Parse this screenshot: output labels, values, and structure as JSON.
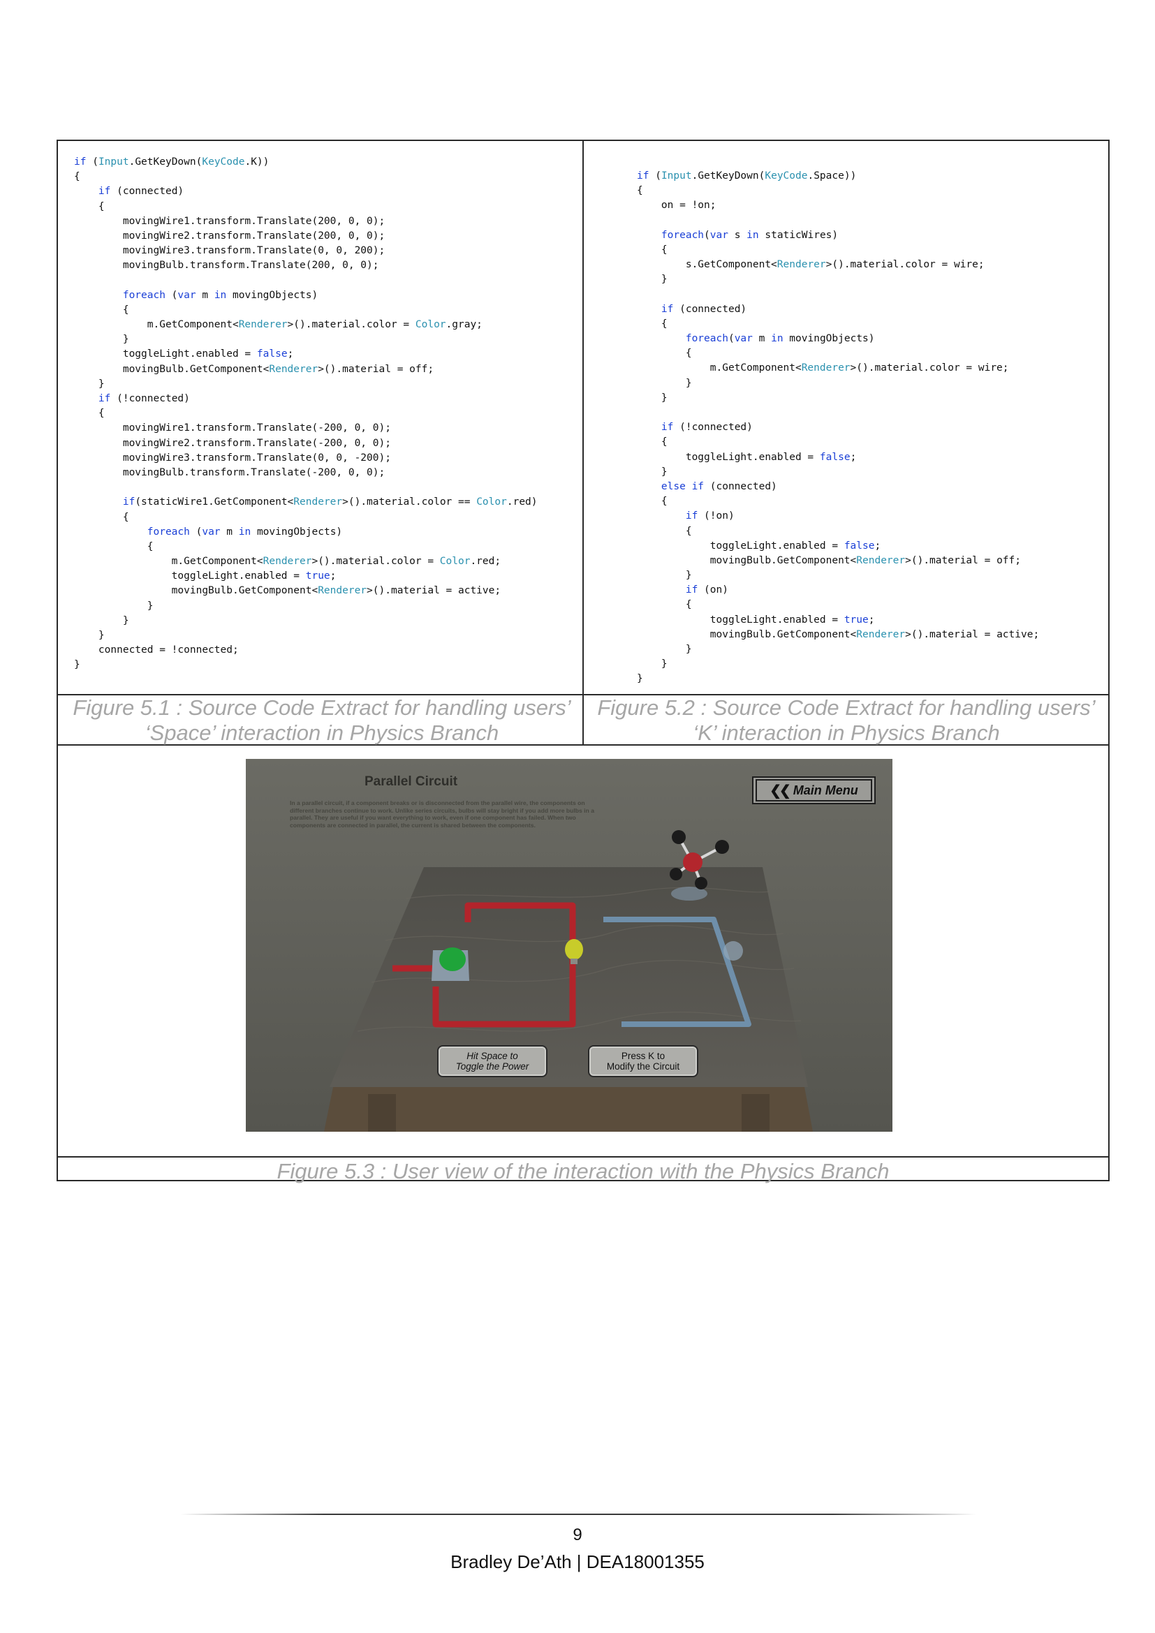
{
  "code_left": [
    [
      {
        "t": "if",
        "c": "kw"
      },
      {
        "t": " ("
      },
      {
        "t": "Input",
        "c": "ty"
      },
      {
        "t": ".GetKeyDown("
      },
      {
        "t": "KeyCode",
        "c": "ty"
      },
      {
        "t": ".K))"
      }
    ],
    [
      {
        "t": "{"
      }
    ],
    [
      {
        "t": "    "
      },
      {
        "t": "if",
        "c": "kw"
      },
      {
        "t": " (connected)"
      }
    ],
    [
      {
        "t": "    {"
      }
    ],
    [
      {
        "t": "        movingWire1.transform.Translate(200, 0, 0);"
      }
    ],
    [
      {
        "t": "        movingWire2.transform.Translate(200, 0, 0);"
      }
    ],
    [
      {
        "t": "        movingWire3.transform.Translate(0, 0, 200);"
      }
    ],
    [
      {
        "t": "        movingBulb.transform.Translate(200, 0, 0);"
      }
    ],
    [
      {
        "t": ""
      }
    ],
    [
      {
        "t": "        "
      },
      {
        "t": "foreach",
        "c": "kw"
      },
      {
        "t": " ("
      },
      {
        "t": "var",
        "c": "kw"
      },
      {
        "t": " m "
      },
      {
        "t": "in",
        "c": "kw"
      },
      {
        "t": " movingObjects)"
      }
    ],
    [
      {
        "t": "        {"
      }
    ],
    [
      {
        "t": "            m.GetComponent<"
      },
      {
        "t": "Renderer",
        "c": "ty"
      },
      {
        "t": ">().material.color = "
      },
      {
        "t": "Color",
        "c": "ty"
      },
      {
        "t": ".gray;"
      }
    ],
    [
      {
        "t": "        }"
      }
    ],
    [
      {
        "t": "        toggleLight.enabled = "
      },
      {
        "t": "false",
        "c": "kw"
      },
      {
        "t": ";"
      }
    ],
    [
      {
        "t": "        movingBulb.GetComponent<"
      },
      {
        "t": "Renderer",
        "c": "ty"
      },
      {
        "t": ">().material = off;"
      }
    ],
    [
      {
        "t": "    }"
      }
    ],
    [
      {
        "t": "    "
      },
      {
        "t": "if",
        "c": "kw"
      },
      {
        "t": " (!connected)"
      }
    ],
    [
      {
        "t": "    {"
      }
    ],
    [
      {
        "t": "        movingWire1.transform.Translate(-200, 0, 0);"
      }
    ],
    [
      {
        "t": "        movingWire2.transform.Translate(-200, 0, 0);"
      }
    ],
    [
      {
        "t": "        movingWire3.transform.Translate(0, 0, -200);"
      }
    ],
    [
      {
        "t": "        movingBulb.transform.Translate(-200, 0, 0);"
      }
    ],
    [
      {
        "t": ""
      }
    ],
    [
      {
        "t": "        "
      },
      {
        "t": "if",
        "c": "kw"
      },
      {
        "t": "(staticWire1.GetComponent<"
      },
      {
        "t": "Renderer",
        "c": "ty"
      },
      {
        "t": ">().material.color == "
      },
      {
        "t": "Color",
        "c": "ty"
      },
      {
        "t": ".red)"
      }
    ],
    [
      {
        "t": "        {"
      }
    ],
    [
      {
        "t": "            "
      },
      {
        "t": "foreach",
        "c": "kw"
      },
      {
        "t": " ("
      },
      {
        "t": "var",
        "c": "kw"
      },
      {
        "t": " m "
      },
      {
        "t": "in",
        "c": "kw"
      },
      {
        "t": " movingObjects)"
      }
    ],
    [
      {
        "t": "            {"
      }
    ],
    [
      {
        "t": "                m.GetComponent<"
      },
      {
        "t": "Renderer",
        "c": "ty"
      },
      {
        "t": ">().material.color = "
      },
      {
        "t": "Color",
        "c": "ty"
      },
      {
        "t": ".red;"
      }
    ],
    [
      {
        "t": "                toggleLight.enabled = "
      },
      {
        "t": "true",
        "c": "kw"
      },
      {
        "t": ";"
      }
    ],
    [
      {
        "t": "                movingBulb.GetComponent<"
      },
      {
        "t": "Renderer",
        "c": "ty"
      },
      {
        "t": ">().material = active;"
      }
    ],
    [
      {
        "t": "            }"
      }
    ],
    [
      {
        "t": "        }"
      }
    ],
    [
      {
        "t": "    }"
      }
    ],
    [
      {
        "t": "    connected = !connected;"
      }
    ],
    [
      {
        "t": "}"
      }
    ]
  ],
  "code_right": [
    [
      {
        "t": "if",
        "c": "kw"
      },
      {
        "t": " ("
      },
      {
        "t": "Input",
        "c": "ty"
      },
      {
        "t": ".GetKeyDown("
      },
      {
        "t": "KeyCode",
        "c": "ty"
      },
      {
        "t": ".Space))"
      }
    ],
    [
      {
        "t": "{"
      }
    ],
    [
      {
        "t": "    on = !on;"
      }
    ],
    [
      {
        "t": ""
      }
    ],
    [
      {
        "t": "    "
      },
      {
        "t": "foreach",
        "c": "kw"
      },
      {
        "t": "("
      },
      {
        "t": "var",
        "c": "kw"
      },
      {
        "t": " s "
      },
      {
        "t": "in",
        "c": "kw"
      },
      {
        "t": " staticWires)"
      }
    ],
    [
      {
        "t": "    {"
      }
    ],
    [
      {
        "t": "        s.GetComponent<"
      },
      {
        "t": "Renderer",
        "c": "ty"
      },
      {
        "t": ">().material.color = wire;"
      }
    ],
    [
      {
        "t": "    }"
      }
    ],
    [
      {
        "t": ""
      }
    ],
    [
      {
        "t": "    "
      },
      {
        "t": "if",
        "c": "kw"
      },
      {
        "t": " (connected)"
      }
    ],
    [
      {
        "t": "    {"
      }
    ],
    [
      {
        "t": "        "
      },
      {
        "t": "foreach",
        "c": "kw"
      },
      {
        "t": "("
      },
      {
        "t": "var",
        "c": "kw"
      },
      {
        "t": " m "
      },
      {
        "t": "in",
        "c": "kw"
      },
      {
        "t": " movingObjects)"
      }
    ],
    [
      {
        "t": "        {"
      }
    ],
    [
      {
        "t": "            m.GetComponent<"
      },
      {
        "t": "Renderer",
        "c": "ty"
      },
      {
        "t": ">().material.color = wire;"
      }
    ],
    [
      {
        "t": "        }"
      }
    ],
    [
      {
        "t": "    }"
      }
    ],
    [
      {
        "t": ""
      }
    ],
    [
      {
        "t": "    "
      },
      {
        "t": "if",
        "c": "kw"
      },
      {
        "t": " (!connected)"
      }
    ],
    [
      {
        "t": "    {"
      }
    ],
    [
      {
        "t": "        toggleLight.enabled = "
      },
      {
        "t": "false",
        "c": "kw"
      },
      {
        "t": ";"
      }
    ],
    [
      {
        "t": "    }"
      }
    ],
    [
      {
        "t": "    "
      },
      {
        "t": "else if",
        "c": "kw"
      },
      {
        "t": " (connected)"
      }
    ],
    [
      {
        "t": "    {"
      }
    ],
    [
      {
        "t": "        "
      },
      {
        "t": "if",
        "c": "kw"
      },
      {
        "t": " (!on)"
      }
    ],
    [
      {
        "t": "        {"
      }
    ],
    [
      {
        "t": "            toggleLight.enabled = "
      },
      {
        "t": "false",
        "c": "kw"
      },
      {
        "t": ";"
      }
    ],
    [
      {
        "t": "            movingBulb.GetComponent<"
      },
      {
        "t": "Renderer",
        "c": "ty"
      },
      {
        "t": ">().material = off;"
      }
    ],
    [
      {
        "t": "        }"
      }
    ],
    [
      {
        "t": "        "
      },
      {
        "t": "if",
        "c": "kw"
      },
      {
        "t": " (on)"
      }
    ],
    [
      {
        "t": "        {"
      }
    ],
    [
      {
        "t": "            toggleLight.enabled = "
      },
      {
        "t": "true",
        "c": "kw"
      },
      {
        "t": ";"
      }
    ],
    [
      {
        "t": "            movingBulb.GetComponent<"
      },
      {
        "t": "Renderer",
        "c": "ty"
      },
      {
        "t": ">().material = active;"
      }
    ],
    [
      {
        "t": "        }"
      }
    ],
    [
      {
        "t": "    }"
      }
    ],
    [
      {
        "t": "}"
      }
    ]
  ],
  "captions": {
    "fig1": "Figure 5.1 : Source Code Extract for handling users’ ‘Space’ interaction in Physics Branch",
    "fig2": "Figure 5.2 : Source Code Extract for handling users’ ‘K’ interaction in Physics Branch",
    "fig3": "Figure 5.3 : User view of the interaction with the Physics Branch"
  },
  "scene": {
    "title": "Parallel Circuit",
    "description": "In a parallel circuit, if a component breaks or is disconnected from the parallel wire, the components on different branches continue to work. Unlike series circuits, bulbs will stay bright if you add more bulbs in a parallel. They are useful if you want everything to work, even if one component has failed. When two components are connected in parallel, the current is shared between the components.",
    "menu_label": "Main Menu",
    "menu_icon": "double-chevron-left-icon",
    "hint_power": "Hit Space to\nToggle the Power",
    "hint_circuit": "Press K to\nModify the Circuit"
  },
  "footer": {
    "page_number": "9",
    "author": "Bradley De’Ath | DEA18001355"
  }
}
